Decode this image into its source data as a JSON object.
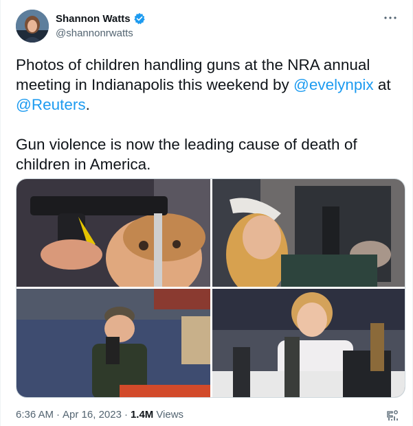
{
  "author": {
    "name": "Shannon Watts",
    "handle": "@shannonrwatts",
    "verified": true
  },
  "tweet": {
    "paragraph1_before": "Photos of children handling guns at the NRA annual meeting in Indianapolis this weekend by ",
    "mention1": "@evelynpix",
    "paragraph1_mid": " at ",
    "mention2": "@Reuters",
    "paragraph1_end": ".",
    "paragraph2": "Gun violence is now the leading cause of death of children in America."
  },
  "media": {
    "photo_count": 4
  },
  "meta": {
    "time": "6:36 AM",
    "separator1": "·",
    "date": "Apr 16, 2023",
    "separator2": "·",
    "views_count": "1.4M",
    "views_label": "Views"
  },
  "colors": {
    "link": "#1d9bf0",
    "verified": "#1d9bf0",
    "secondary_text": "#536471",
    "primary_text": "#0f1419"
  },
  "icons": {
    "more": "more-icon",
    "verified": "verified-badge-icon",
    "analytics": "analytics-icon"
  }
}
